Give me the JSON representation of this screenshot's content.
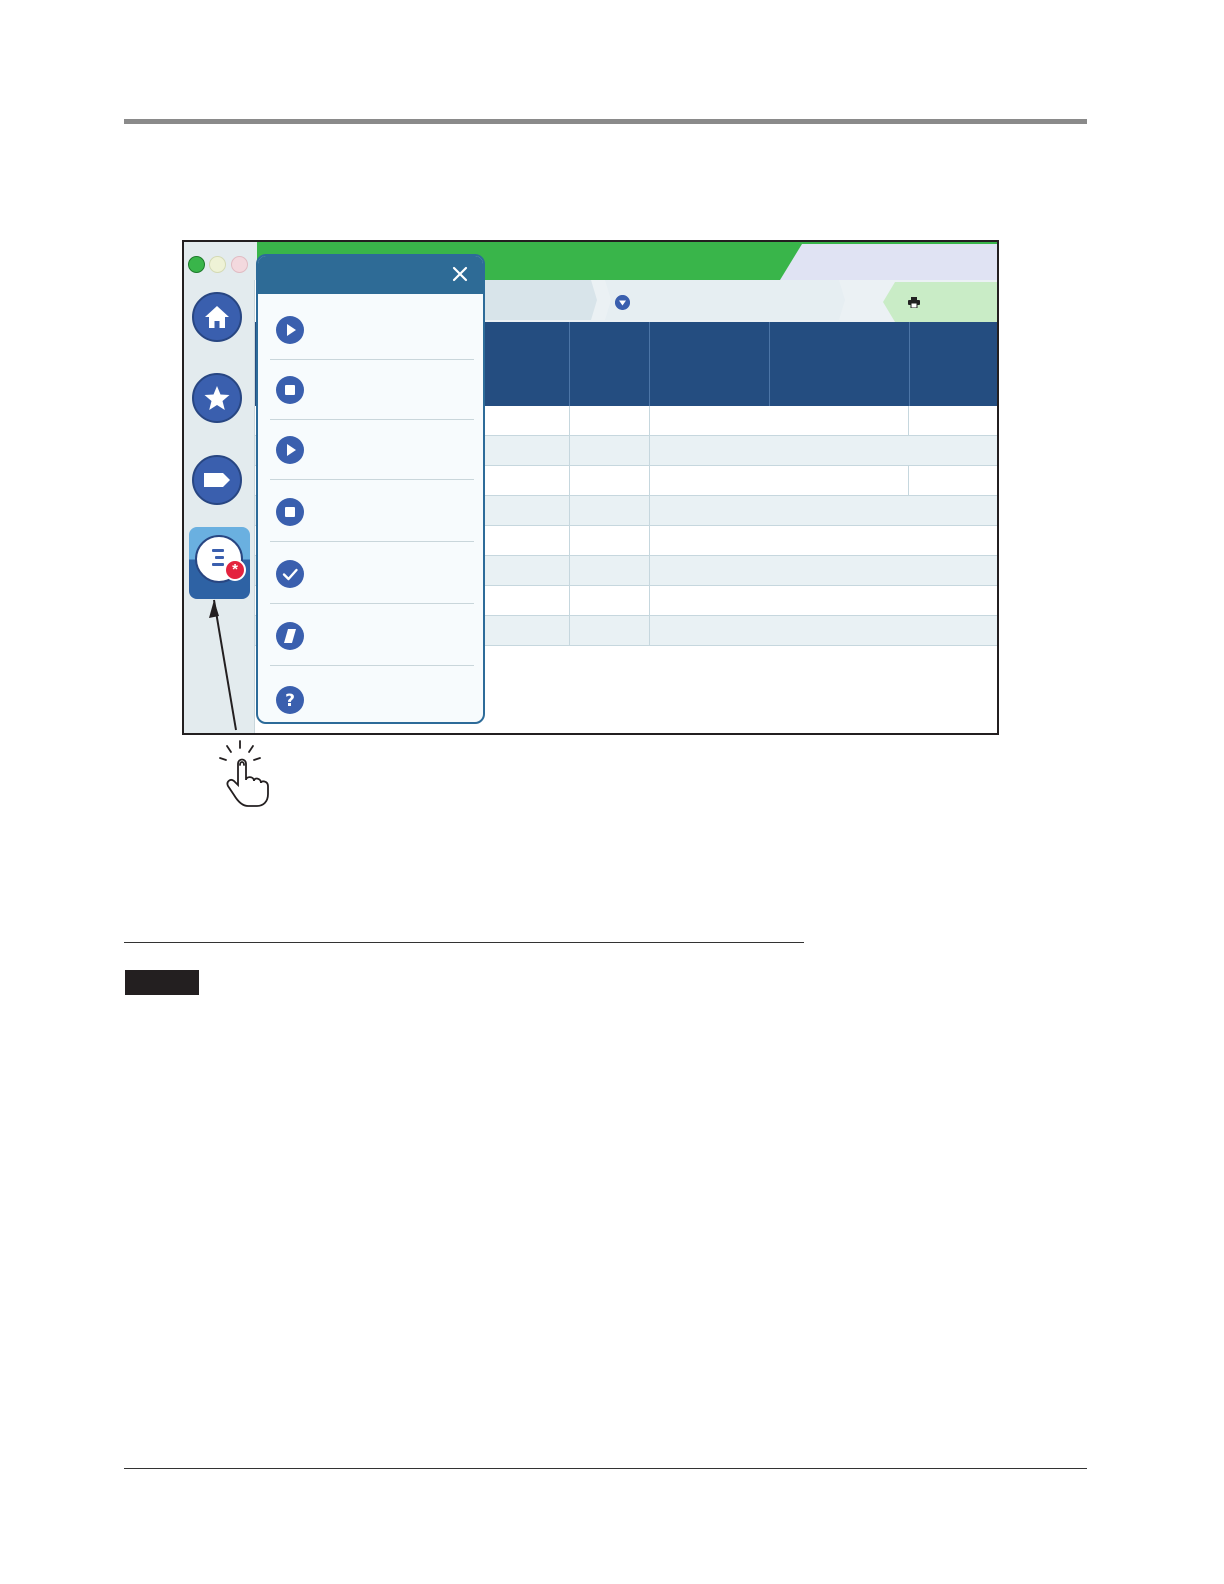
{
  "colors": {
    "title_bar": "#39b54a",
    "nav_button": "#3a5fae",
    "table_header": "#244d80",
    "popup_header": "#2e6b96",
    "badge": "#e4233e",
    "print_tab": "#c9ecc6"
  },
  "window": {
    "title": "",
    "traffic_lights": [
      "green",
      "yellow",
      "red"
    ]
  },
  "sidebar": {
    "items": [
      {
        "icon": "home-icon",
        "label": ""
      },
      {
        "icon": "star-icon",
        "label": ""
      },
      {
        "icon": "tag-icon",
        "label": ""
      },
      {
        "icon": "menu-list-icon",
        "label": "",
        "active": true,
        "badge_icon": "asterisk-icon"
      }
    ]
  },
  "breadcrumb": {
    "items": [
      {
        "label": ""
      },
      {
        "label": ""
      }
    ],
    "dropdown_icon": "chevron-down-icon",
    "print_icon": "printer-icon"
  },
  "popup": {
    "title": "",
    "close_icon": "close-icon",
    "items": [
      {
        "icon": "play-icon",
        "label": ""
      },
      {
        "icon": "stop-icon",
        "label": ""
      },
      {
        "icon": "play-icon",
        "label": ""
      },
      {
        "icon": "stop-icon",
        "label": ""
      },
      {
        "icon": "check-icon",
        "label": ""
      },
      {
        "icon": "eraser-icon",
        "label": ""
      },
      {
        "icon": "help-icon",
        "label": ""
      }
    ]
  },
  "table": {
    "headers": [
      "",
      "",
      "",
      "",
      "",
      ""
    ],
    "row_count": 8
  },
  "annotation": {
    "pointer_icon": "tap-hand-icon"
  }
}
